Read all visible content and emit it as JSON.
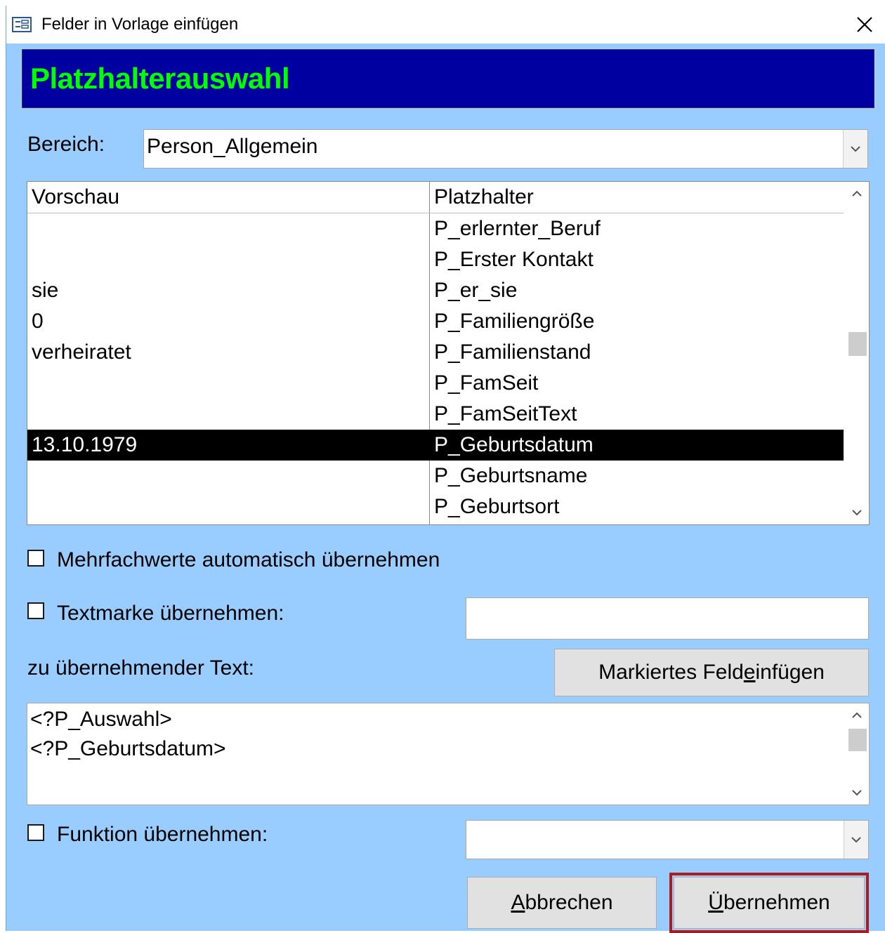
{
  "window": {
    "title": "Felder in Vorlage einfügen",
    "icon": "form-icon",
    "close_icon": "close-icon"
  },
  "banner": {
    "text": "Platzhalterauswahl",
    "bg": "#0000a0",
    "fg": "#00ff00"
  },
  "bereich": {
    "label": "Bereich:",
    "value": "Person_Allgemein"
  },
  "listbox": {
    "headers": [
      "Vorschau",
      "Platzhalter"
    ],
    "rows": [
      {
        "vorschau": "",
        "platzhalter": "P_erlernter_Beruf",
        "selected": false
      },
      {
        "vorschau": "",
        "platzhalter": "P_Erster Kontakt",
        "selected": false
      },
      {
        "vorschau": "sie",
        "platzhalter": "P_er_sie",
        "selected": false
      },
      {
        "vorschau": "0",
        "platzhalter": "P_Familiengröße",
        "selected": false
      },
      {
        "vorschau": "verheiratet",
        "platzhalter": "P_Familienstand",
        "selected": false
      },
      {
        "vorschau": "",
        "platzhalter": "P_FamSeit",
        "selected": false
      },
      {
        "vorschau": "",
        "platzhalter": "P_FamSeitText",
        "selected": false
      },
      {
        "vorschau": "13.10.1979",
        "platzhalter": "P_Geburtsdatum",
        "selected": true
      },
      {
        "vorschau": "",
        "platzhalter": "P_Geburtsname",
        "selected": false
      },
      {
        "vorschau": "",
        "platzhalter": "P_Geburtsort",
        "selected": false
      }
    ]
  },
  "options": {
    "mehrfachwerte": {
      "label": "Mehrfachwerte automatisch übernehmen",
      "checked": false
    },
    "textmarke": {
      "label": "Textmarke übernehmen:",
      "checked": false,
      "value": ""
    },
    "funktion": {
      "label": "Funktion übernehmen:",
      "checked": false,
      "value": ""
    }
  },
  "text_section": {
    "label": "zu übernehmender Text:",
    "insert_button": "Markiertes Feld einfügen",
    "lines": [
      "<?P_Auswahl>",
      "<?P_Geburtsdatum>"
    ]
  },
  "buttons": {
    "cancel": "Abbrechen",
    "apply": "Übernehmen"
  },
  "colors": {
    "dialog_bg": "#99ccff",
    "focus_border": "#b01a1a",
    "selection": "#000000"
  }
}
